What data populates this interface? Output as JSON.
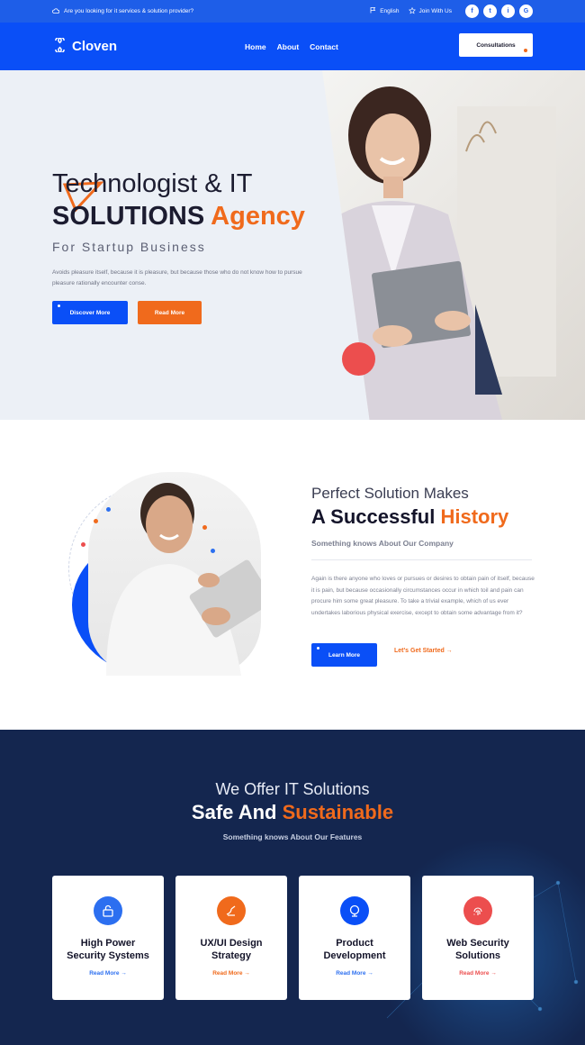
{
  "topbar": {
    "question": "Are you looking for it services & solution provider?",
    "language": "English",
    "join": "Join With Us",
    "social": [
      "f",
      "t",
      "i",
      "G"
    ]
  },
  "header": {
    "logo": "Cloven",
    "nav": [
      "Home",
      "About",
      "Contact"
    ],
    "cta": "Consultations"
  },
  "hero": {
    "title_line1": "Technologist & IT",
    "title_line2_dark": "SOLUTIONS",
    "title_line2_accent": "Agency",
    "subtitle": "For Startup Business",
    "paragraph": "Avoids pleasure itself, because it is pleasure, but because those who do not know how to pursue pleasure rationally encounter conse.",
    "btn_primary": "Discover More",
    "btn_secondary": "Read More"
  },
  "about": {
    "heading_light": "Perfect Solution Makes",
    "heading_dark": "A Successful",
    "heading_accent": "History",
    "tagline": "Something knows About Our Company",
    "paragraph": "Again is there anyone who loves or pursues or desires to obtain pain of itself, because it is pain, but because occasionally circumstances occur in which toil and pain can procure him some great pleasure. To take a trivial example, which of us ever undertakes laborious physical exercise, except to obtain some advantage from it?",
    "btn_learn": "Learn More",
    "link_start": "Let's Get Started →"
  },
  "services": {
    "heading_light": "We Offer IT Solutions",
    "heading_dark": "Safe And",
    "heading_accent": "Sustainable",
    "tagline": "Something knows About Our Features",
    "cards": [
      {
        "title1": "High Power",
        "title2": "Security Systems",
        "link": "Read More →",
        "icon": "lock-icon",
        "color": "#2c6ff0",
        "link_color": "#2c6ff0"
      },
      {
        "title1": "UX/UI Design",
        "title2": "Strategy",
        "link": "Read More →",
        "icon": "design-icon",
        "color": "#f06a1c",
        "link_color": "#f06a1c"
      },
      {
        "title1": "Product",
        "title2": "Development",
        "link": "Read More →",
        "icon": "globe-icon",
        "color": "#0a4ff7",
        "link_color": "#2c6ff0"
      },
      {
        "title1": "Web Security",
        "title2": "Solutions",
        "link": "Read More →",
        "icon": "fingerprint-icon",
        "color": "#ec4e4e",
        "link_color": "#ec4e4e"
      }
    ]
  },
  "colors": {
    "primary": "#0a4ff7",
    "accent": "#f06a1c",
    "dark": "#14264f",
    "red": "#ec4e4e"
  }
}
